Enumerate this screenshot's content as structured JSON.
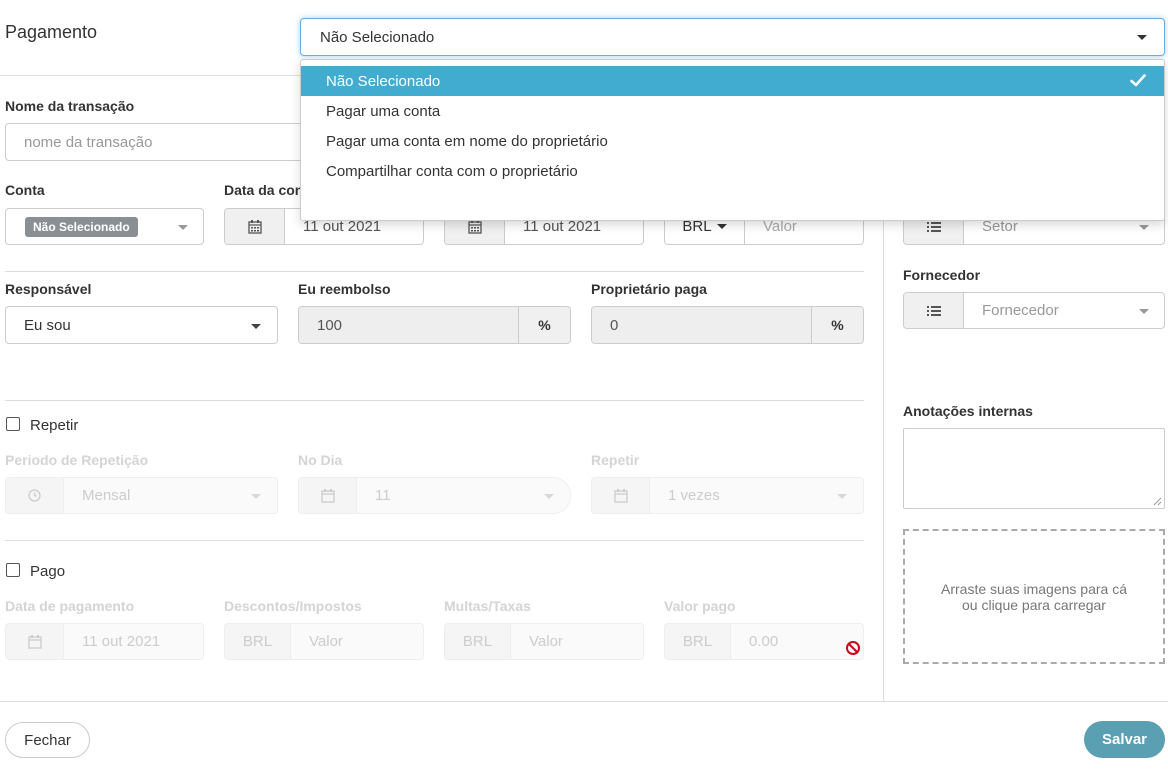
{
  "header": {
    "title": "Pagamento"
  },
  "payment_select": {
    "value": "Não Selecionado",
    "options": [
      {
        "label": "Não Selecionado",
        "selected": true
      },
      {
        "label": "Pagar uma conta",
        "selected": false
      },
      {
        "label": "Pagar uma conta em nome do proprietário",
        "selected": false
      },
      {
        "label": "Compartilhar conta com o proprietário",
        "selected": false
      }
    ]
  },
  "transaction": {
    "label": "Nome da transação",
    "placeholder": "nome da transação"
  },
  "account": {
    "label": "Conta",
    "value": "Não Selecionado"
  },
  "due_date": {
    "label": "Data da con",
    "value": "11 out 2021"
  },
  "second_date": {
    "value": "11 out 2021"
  },
  "amount": {
    "currency": "BRL",
    "placeholder": "Valor"
  },
  "sector": {
    "placeholder": "Setor"
  },
  "supplier": {
    "label": "Fornecedor",
    "placeholder": "Fornecedor"
  },
  "responsible": {
    "label": "Responsável",
    "value": "Eu sou"
  },
  "reimburse": {
    "label": "Eu reembolso",
    "value": "100",
    "unit": "%"
  },
  "owner_pays": {
    "label": "Proprietário paga",
    "value": "0",
    "unit": "%"
  },
  "repeat": {
    "checkbox_label": "Repetir",
    "period_label": "Periodo de Repetição",
    "period_value": "Mensal",
    "day_label": "No Dia",
    "day_value": "11",
    "times_label": "Repetir",
    "times_value": "1 vezes"
  },
  "paid": {
    "checkbox_label": "Pago",
    "date_label": "Data de pagamento",
    "date_value": "11 out 2021",
    "discount_label": "Descontos/Impostos",
    "discount_currency": "BRL",
    "discount_placeholder": "Valor",
    "fees_label": "Multas/Taxas",
    "fees_currency": "BRL",
    "fees_placeholder": "Valor",
    "paid_label": "Valor pago",
    "paid_currency": "BRL",
    "paid_value": "0.00"
  },
  "notes": {
    "label": "Anotações internas"
  },
  "upload": {
    "text": "Arraste suas imagens para cá ou clique para carregar"
  },
  "footer": {
    "close": "Fechar",
    "save": "Salvar"
  },
  "colors": {
    "accent": "#41acd0",
    "save_button": "#5b9fb3",
    "blocked": "#d0021b"
  }
}
